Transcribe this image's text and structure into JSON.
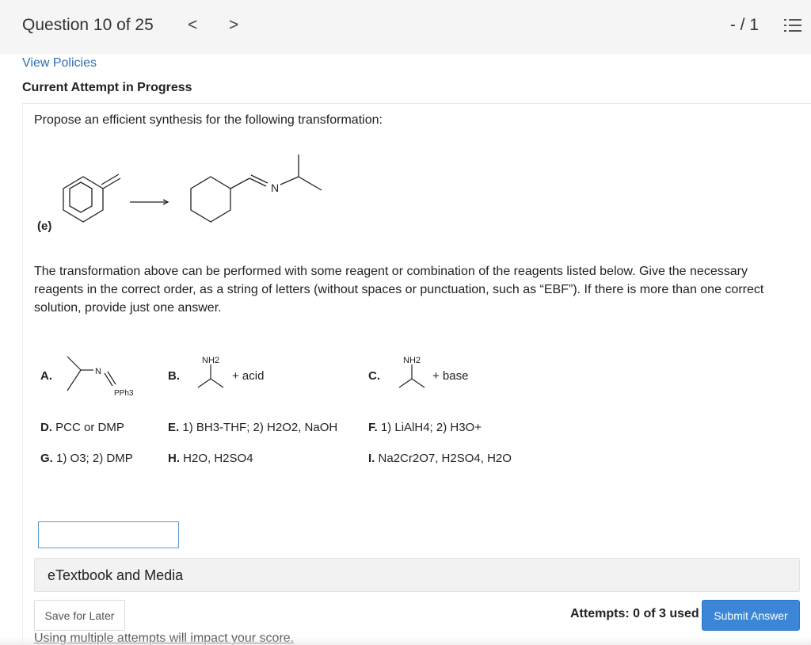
{
  "header": {
    "question_label": "Question 10 of 25",
    "prev_icon": "chevron-left-icon",
    "next_icon": "chevron-right-icon",
    "prev_glyph": "<",
    "next_glyph": ">",
    "score": "- / 1",
    "list_icon": "numbered-list-icon"
  },
  "links": {
    "view_policies": "View Policies"
  },
  "status": {
    "attempt": "Current Attempt in Progress"
  },
  "question": {
    "prompt": "Propose an efficient synthesis for the following transformation:",
    "part_label": "(e)",
    "product_atom": "N",
    "instructions": "The transformation above can be performed with some reagent or combination of the reagents listed below. Give the necessary reagents in the correct order, as a string of letters (without spaces or punctuation, such as “EBF”). If there is more than one correct solution, provide just one answer."
  },
  "reagents": {
    "A": {
      "letter": "A.",
      "atom": "N",
      "group": "PPh3"
    },
    "B": {
      "letter": "B.",
      "group": "NH2",
      "text": "+ acid"
    },
    "C": {
      "letter": "C.",
      "group": "NH2",
      "text": "+ base"
    },
    "D": {
      "letter": "D.",
      "text": "PCC or DMP"
    },
    "E": {
      "letter": "E.",
      "text": "1) BH3-THF; 2) H2O2, NaOH"
    },
    "F": {
      "letter": "F.",
      "text": "1) LiAlH4; 2) H3O+"
    },
    "G": {
      "letter": "G.",
      "text": "1) O3; 2) DMP"
    },
    "H": {
      "letter": "H.",
      "text": "H2O, H2SO4"
    },
    "I": {
      "letter": "I.",
      "text": "Na2Cr2O7, H2SO4, H2O"
    }
  },
  "answer": {
    "value": "",
    "placeholder": ""
  },
  "etextbook": {
    "label": "eTextbook and Media"
  },
  "footer": {
    "save_label": "Save for Later",
    "attempts": "Attempts: 0 of 3 used",
    "submit_label": "Submit Answer",
    "warning": "Using multiple attempts will impact your score."
  },
  "colors": {
    "link": "#2f6fb1",
    "submit": "#3b86d6",
    "input_border": "#5b9bd5",
    "header_bg": "#f5f5f5"
  }
}
